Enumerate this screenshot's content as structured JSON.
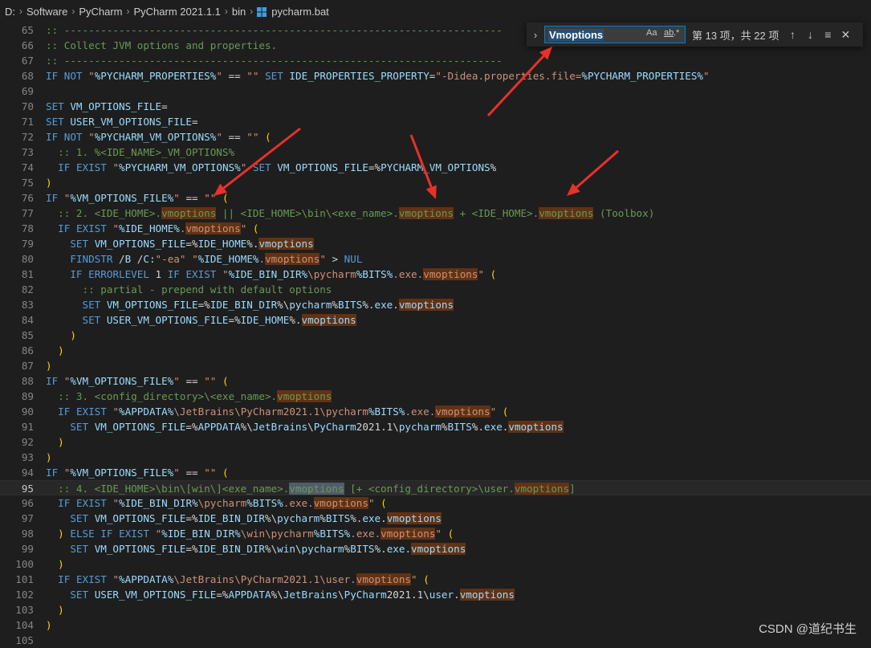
{
  "breadcrumb": {
    "segments": [
      "D:",
      "Software",
      "PyCharm",
      "PyCharm 2021.1.1",
      "bin"
    ],
    "file": "pycharm.bat",
    "file_icon": "windows-logo-icon"
  },
  "find_widget": {
    "query": "Vmoptions",
    "match_case_label": "Aa",
    "whole_word_label": "ab",
    "regex_label": ".*",
    "result_count": "第 13 项，共 22 项",
    "toggle_icon": "chevron-right-icon",
    "prev_icon": "arrow-up-icon",
    "next_icon": "arrow-down-icon",
    "selection_icon": "find-in-selection-icon",
    "close_icon": "close-icon"
  },
  "editor": {
    "current_line": "95",
    "lines": [
      {
        "n": "65",
        "t": ":: ------------------------------------------------------------------------"
      },
      {
        "n": "66",
        "t": ":: Collect JVM options and properties."
      },
      {
        "n": "67",
        "t": ":: ------------------------------------------------------------------------"
      },
      {
        "n": "68",
        "t": "IF NOT \"%PYCHARM_PROPERTIES%\" == \"\" SET IDE_PROPERTIES_PROPERTY=\"-Didea.properties.file=%PYCHARM_PROPERTIES%\""
      },
      {
        "n": "69",
        "t": ""
      },
      {
        "n": "70",
        "t": "SET VM_OPTIONS_FILE="
      },
      {
        "n": "71",
        "t": "SET USER_VM_OPTIONS_FILE="
      },
      {
        "n": "72",
        "t": "IF NOT \"%PYCHARM_VM_OPTIONS%\" == \"\" ("
      },
      {
        "n": "73",
        "t": "  :: 1. %<IDE_NAME>_VM_OPTIONS%"
      },
      {
        "n": "74",
        "t": "  IF EXIST \"%PYCHARM_VM_OPTIONS%\" SET VM_OPTIONS_FILE=%PYCHARM_VM_OPTIONS%"
      },
      {
        "n": "75",
        "t": ")"
      },
      {
        "n": "76",
        "t": "IF \"%VM_OPTIONS_FILE%\" == \"\" ("
      },
      {
        "n": "77",
        "t": "  :: 2. <IDE_HOME>.vmoptions || <IDE_HOME>\\bin\\<exe_name>.vmoptions + <IDE_HOME>.vmoptions (Toolbox)"
      },
      {
        "n": "78",
        "t": "  IF EXIST \"%IDE_HOME%.vmoptions\" ("
      },
      {
        "n": "79",
        "t": "    SET VM_OPTIONS_FILE=%IDE_HOME%.vmoptions"
      },
      {
        "n": "80",
        "t": "    FINDSTR /B /C:\"-ea\" \"%IDE_HOME%.vmoptions\" > NUL"
      },
      {
        "n": "81",
        "t": "    IF ERRORLEVEL 1 IF EXIST \"%IDE_BIN_DIR%\\pycharm%BITS%.exe.vmoptions\" ("
      },
      {
        "n": "82",
        "t": "      :: partial - prepend with default options"
      },
      {
        "n": "83",
        "t": "      SET VM_OPTIONS_FILE=%IDE_BIN_DIR%\\pycharm%BITS%.exe.vmoptions"
      },
      {
        "n": "84",
        "t": "      SET USER_VM_OPTIONS_FILE=%IDE_HOME%.vmoptions"
      },
      {
        "n": "85",
        "t": "    )"
      },
      {
        "n": "86",
        "t": "  )"
      },
      {
        "n": "87",
        "t": ")"
      },
      {
        "n": "88",
        "t": "IF \"%VM_OPTIONS_FILE%\" == \"\" ("
      },
      {
        "n": "89",
        "t": "  :: 3. <config_directory>\\<exe_name>.vmoptions"
      },
      {
        "n": "90",
        "t": "  IF EXIST \"%APPDATA%\\JetBrains\\PyCharm2021.1\\pycharm%BITS%.exe.vmoptions\" ("
      },
      {
        "n": "91",
        "t": "    SET VM_OPTIONS_FILE=%APPDATA%\\JetBrains\\PyCharm2021.1\\pycharm%BITS%.exe.vmoptions"
      },
      {
        "n": "92",
        "t": "  )"
      },
      {
        "n": "93",
        "t": ")"
      },
      {
        "n": "94",
        "t": "IF \"%VM_OPTIONS_FILE%\" == \"\" ("
      },
      {
        "n": "95",
        "t": "  :: 4. <IDE_HOME>\\bin\\[win\\]<exe_name>.vmoptions [+ <config_directory>\\user.vmoptions]"
      },
      {
        "n": "96",
        "t": "  IF EXIST \"%IDE_BIN_DIR%\\pycharm%BITS%.exe.vmoptions\" ("
      },
      {
        "n": "97",
        "t": "    SET VM_OPTIONS_FILE=%IDE_BIN_DIR%\\pycharm%BITS%.exe.vmoptions"
      },
      {
        "n": "98",
        "t": "  ) ELSE IF EXIST \"%IDE_BIN_DIR%\\win\\pycharm%BITS%.exe.vmoptions\" ("
      },
      {
        "n": "99",
        "t": "    SET VM_OPTIONS_FILE=%IDE_BIN_DIR%\\win\\pycharm%BITS%.exe.vmoptions"
      },
      {
        "n": "100",
        "t": "  )"
      },
      {
        "n": "101",
        "t": "  IF EXIST \"%APPDATA%\\JetBrains\\PyCharm2021.1\\user.vmoptions\" ("
      },
      {
        "n": "102",
        "t": "    SET USER_VM_OPTIONS_FILE=%APPDATA%\\JetBrains\\PyCharm2021.1\\user.vmoptions"
      },
      {
        "n": "103",
        "t": "  )"
      },
      {
        "n": "104",
        "t": ")"
      },
      {
        "n": "105",
        "t": ""
      }
    ]
  },
  "watermark": "CSDN @道纪书生",
  "colors": {
    "background": "#1e1e1e",
    "keyword": "#569cd6",
    "string": "#ce9178",
    "variable": "#9cdcfe",
    "comment": "#6a9955",
    "match_highlight": "#613214",
    "annotation_arrow": "#e8312a"
  }
}
